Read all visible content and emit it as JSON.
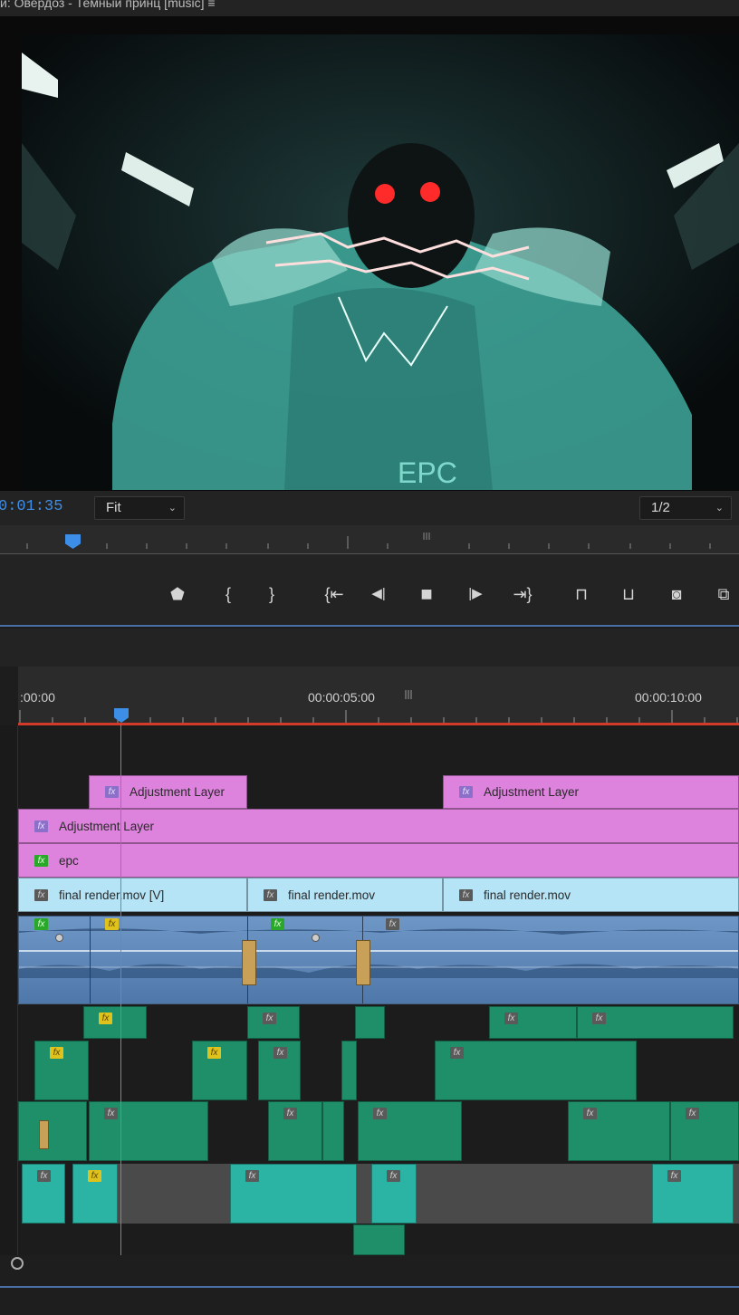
{
  "window": {
    "title": "й: Овердоз - Темный принц [music]  ≡"
  },
  "viewer": {
    "timecode": "0:01:35",
    "zoom_value": "Fit",
    "resolution_value": "1/2",
    "frame_text": "EPC"
  },
  "transport": {
    "buttons": [
      "marker-icon",
      "mark-in-icon",
      "mark-out-icon",
      "go-to-in-icon",
      "step-back-icon",
      "stop-icon",
      "step-forward-icon",
      "go-to-out-icon",
      "lift-icon",
      "extract-icon",
      "export-frame-icon",
      "compare-icon"
    ],
    "glyphs": {
      "marker": "⬟",
      "mark_in": "{",
      "mark_out": "}",
      "go_in": "{⇤",
      "step_back": "◀|",
      "stop": "■",
      "step_fwd": "|▶",
      "go_out": "⇥}",
      "lift": "⊓",
      "extract": "⊔",
      "camera": "◙",
      "compare": "⧉"
    }
  },
  "timeline": {
    "ruler_labels": [
      ":00:00",
      "00:00:05:00",
      "00:00:10:00"
    ],
    "playhead_progress": 0.16,
    "clips": {
      "adj_v5_a": "Adjustment Layer",
      "adj_v5_b": "Adjustment Layer",
      "adj_v4": "Adjustment Layer",
      "epc_v3": "epc",
      "video_v2_a": "final render.mov [V]",
      "video_v2_b": "final render.mov",
      "video_v2_c": "final render.mov"
    },
    "fx_label": "fx"
  },
  "colors": {
    "accent_blue": "#3d8ee6",
    "adjustment_clip": "#dd82dd",
    "video_clip": "#b5e4f7",
    "audio_main": "#6f97c6",
    "audio_green": "#1f8f6a",
    "audio_cyan": "#2bb3a4",
    "work_area": "#d23a2a"
  }
}
